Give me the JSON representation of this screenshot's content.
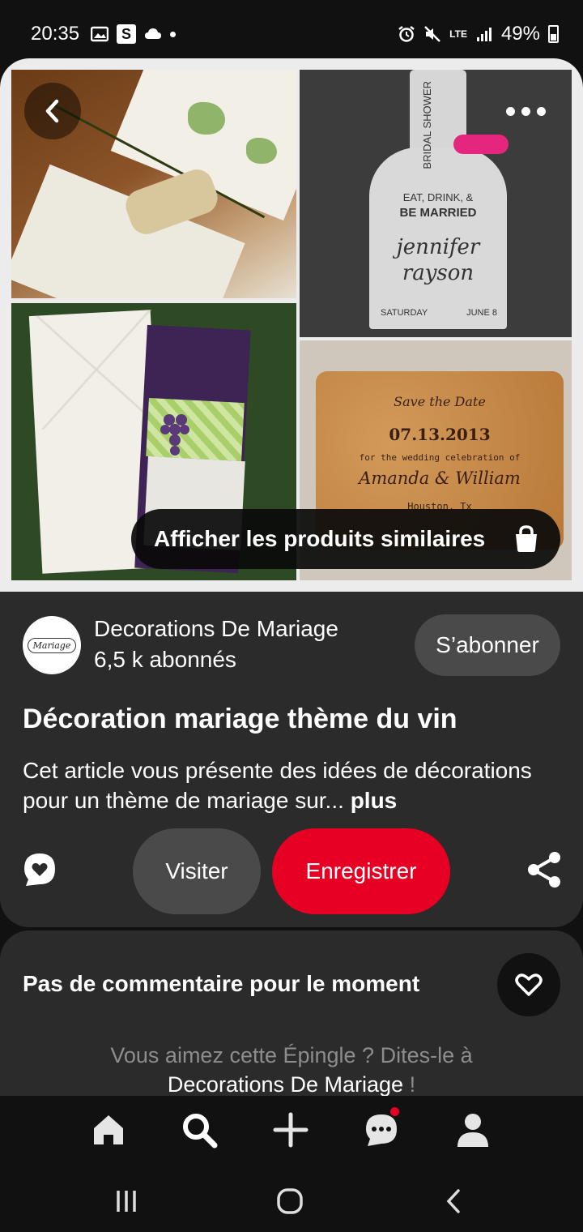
{
  "status_bar": {
    "time": "20:35",
    "network": "LTE",
    "battery": "49%",
    "battery_level": 0.49,
    "icons": [
      "gallery-icon",
      "s-app-icon",
      "cloud-icon",
      "dot-icon",
      "alarm-icon",
      "mute-icon",
      "signal-icon",
      "battery-icon"
    ]
  },
  "pin_image": {
    "bottle_card": {
      "side_text": "BRIDAL SHOWER",
      "line1": "EAT, DRINK, &",
      "line2": "BE MARRIED",
      "name1": "jennifer",
      "name2": "rayson",
      "date_left": "SATURDAY",
      "date_right": "JUNE 8"
    },
    "cork_card": {
      "banner": "Save the Date",
      "date": "07.13.2013",
      "line": "for the wedding celebration of",
      "names": "Amanda & William",
      "place": "Houston, Tx"
    },
    "similar_button": "Afficher les produits similaires"
  },
  "profile": {
    "avatar_text": "Mariage",
    "name": "Decorations De Mariage",
    "followers": "6,5 k abonnés",
    "follow_button": "S’abonner"
  },
  "pin": {
    "title": "Décoration mariage thème du vin",
    "description": "Cet article vous présente des idées de décorations pour un thème de mariage sur...",
    "more": "plus"
  },
  "actions": {
    "visit": "Visiter",
    "save": "Enregistrer"
  },
  "comments": {
    "title": "Pas de commentaire pour le moment",
    "prompt_line1": "Vous aimez cette Épingle ? Dites-le à",
    "prompt_name": "Decorations De Mariage",
    "prompt_end": " !"
  },
  "colors": {
    "accent_red": "#e60023",
    "card_bg": "#2b2b2b",
    "button_gray": "#4a4a4a",
    "background": "#111111"
  },
  "bottom_nav": [
    "home-icon",
    "search-icon",
    "create-icon",
    "messages-icon",
    "profile-icon"
  ]
}
